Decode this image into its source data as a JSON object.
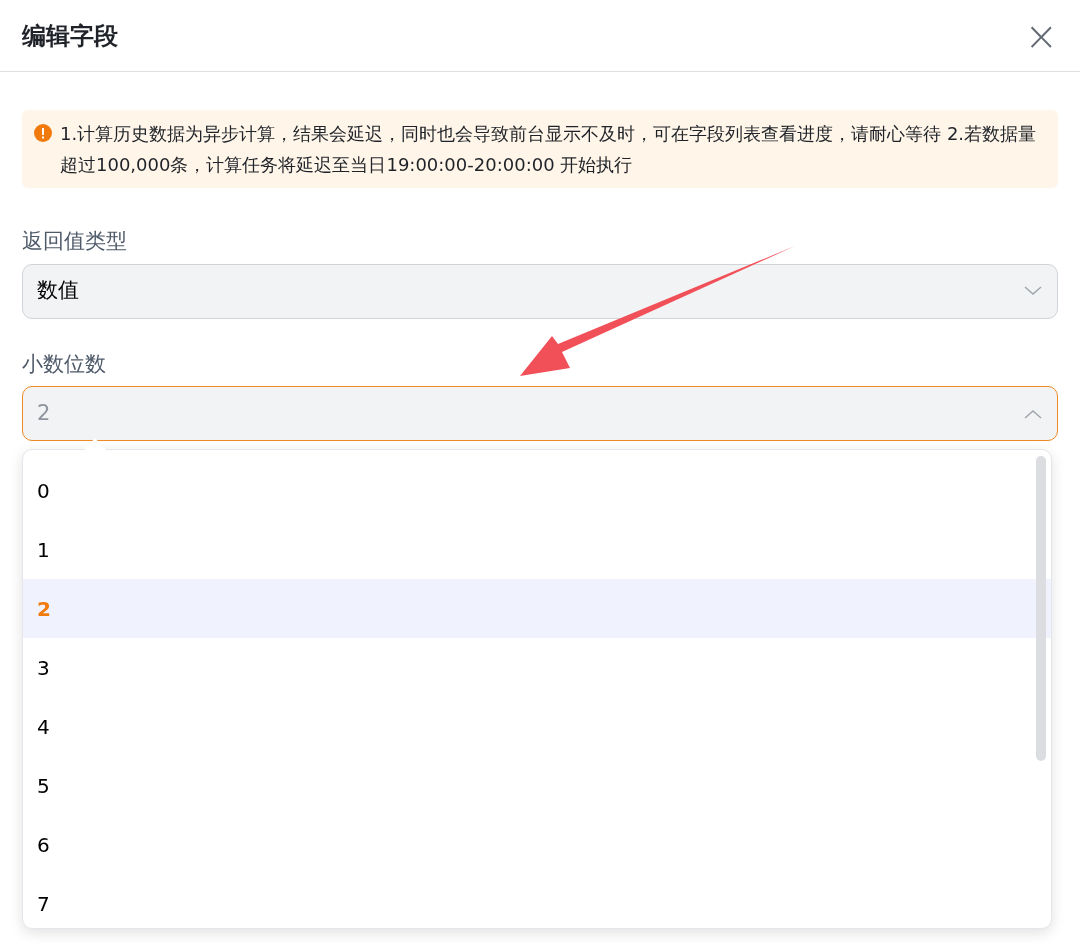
{
  "dialog": {
    "title": "编辑字段",
    "close_icon": "×"
  },
  "alert": {
    "text": "1.计算历史数据为异步计算，结果会延迟，同时也会导致前台显示不及时，可在字段列表查看进度，请耐心等待   2.若数据量超过100,000条，计算任务将延迟至当日19:00:00-20:00:00 开始执行"
  },
  "fields": [
    {
      "label": "返回值类型",
      "value": "数值",
      "expanded": false
    },
    {
      "label": "小数位数",
      "value": "2",
      "expanded": true
    }
  ],
  "dropdown": {
    "options": [
      {
        "label": "0",
        "selected": false
      },
      {
        "label": "1",
        "selected": false
      },
      {
        "label": "2",
        "selected": true
      },
      {
        "label": "3",
        "selected": false
      },
      {
        "label": "4",
        "selected": false
      },
      {
        "label": "5",
        "selected": false
      },
      {
        "label": "6",
        "selected": false
      },
      {
        "label": "7",
        "selected": false
      }
    ]
  }
}
